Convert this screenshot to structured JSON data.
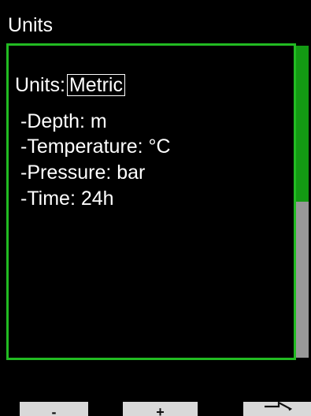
{
  "header": {
    "title": "Units"
  },
  "settings": {
    "units_label": "Units:",
    "units_value": "Metric",
    "lines": [
      "-Depth:  m",
      "-Temperature: °C",
      "-Pressure:  bar",
      "-Time: 24h"
    ]
  },
  "scrollbar": {
    "position_fraction": 0.5,
    "track_color": "#989898",
    "thumb_color": "#139a13"
  },
  "softkeys": {
    "left_label": "-",
    "middle_label": "+",
    "right_icon": "right-arrow-icon"
  },
  "colors": {
    "background": "#000000",
    "frame_border": "#22bb22",
    "text": "#ffffff",
    "softkey_bg": "#d9d9d9"
  }
}
